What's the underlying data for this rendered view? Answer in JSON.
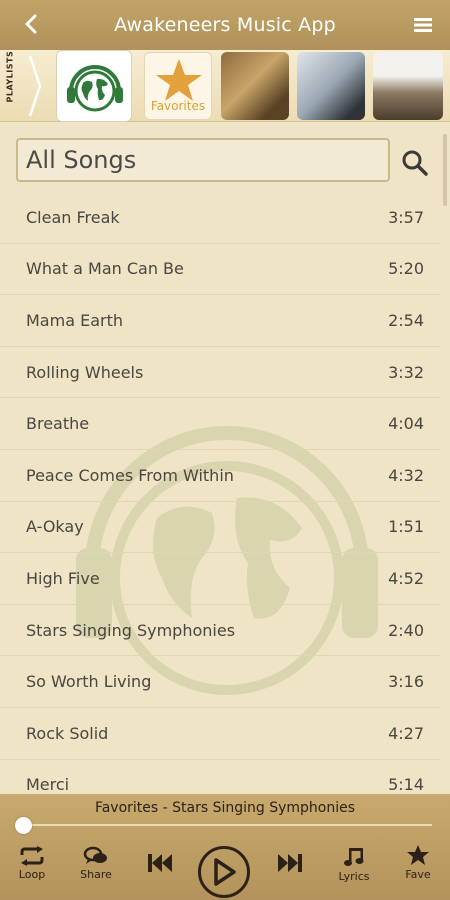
{
  "header": {
    "title": "Awakeneers Music App",
    "back_icon": "back-chevron-icon",
    "menu_icon": "hamburger-menu-icon"
  },
  "playlists": {
    "tab_label": "PLAYLISTS",
    "items": [
      {
        "name": "globe-headphones-playlist"
      },
      {
        "label": "Favorites",
        "icon": "star-icon"
      },
      {
        "name": "album-cover-1"
      },
      {
        "name": "album-cover-2"
      },
      {
        "name": "album-cover-3"
      }
    ]
  },
  "search": {
    "placeholder": "All Songs",
    "icon": "search-icon"
  },
  "songs": [
    {
      "title": "Clean Freak",
      "duration": "3:57"
    },
    {
      "title": "What a Man Can Be",
      "duration": "5:20"
    },
    {
      "title": "Mama Earth",
      "duration": "2:54"
    },
    {
      "title": "Rolling Wheels",
      "duration": "3:32"
    },
    {
      "title": "Breathe",
      "duration": "4:04"
    },
    {
      "title": "Peace Comes From Within",
      "duration": "4:32"
    },
    {
      "title": "A-Okay",
      "duration": "1:51"
    },
    {
      "title": "High Five",
      "duration": "4:52"
    },
    {
      "title": "Stars Singing Symphonies",
      "duration": "2:40"
    },
    {
      "title": "So Worth Living",
      "duration": "3:16"
    },
    {
      "title": "Rock Solid",
      "duration": "4:27"
    },
    {
      "title": "Merci",
      "duration": "5:14"
    }
  ],
  "player": {
    "now_playing": "Favorites - Stars Singing Symphonies",
    "progress": 0,
    "controls": {
      "loop": "Loop",
      "share": "Share",
      "lyrics": "Lyrics",
      "fave": "Fave"
    }
  },
  "colors": {
    "header": "#b89a60",
    "background": "#efe4c6",
    "player": "#bf9f65",
    "accent_star": "#d9a032",
    "icon_dark": "#2c2116"
  }
}
